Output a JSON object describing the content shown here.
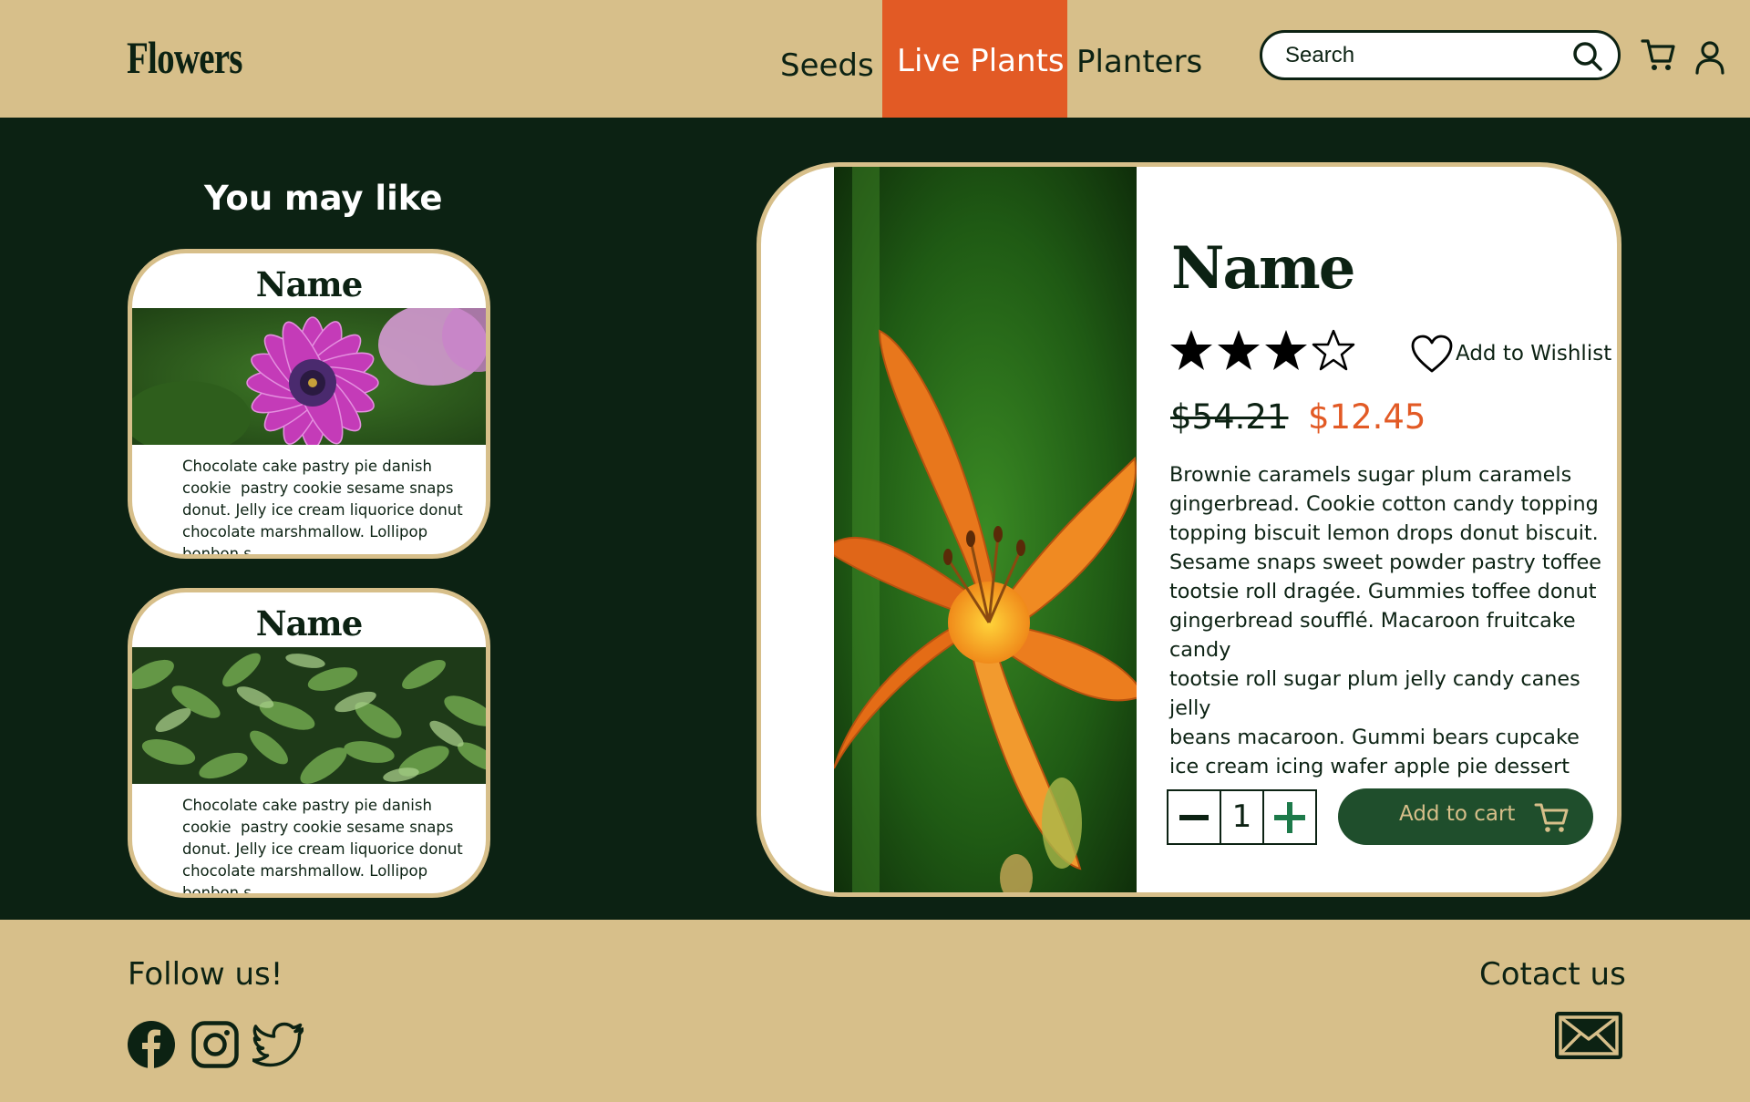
{
  "header": {
    "logo": "Flowers",
    "nav": [
      {
        "label": "Seeds",
        "active": false
      },
      {
        "label": "Live Plants",
        "active": true
      },
      {
        "label": "Planters",
        "active": false
      }
    ],
    "search_placeholder": "Search",
    "icons": [
      "search-icon",
      "cart-icon",
      "user-icon"
    ]
  },
  "sidebar": {
    "title": "You may like",
    "cards": [
      {
        "name": "Name",
        "image": "purple-daisy",
        "text": "Chocolate cake pastry pie danish cookie  pastry cookie sesame snaps donut. Jelly ice cream liquorice donut chocolate marshmallow. Lollipop bonbon s"
      },
      {
        "name": "Name",
        "image": "green-plants",
        "text": "Chocolate cake pastry pie danish cookie  pastry cookie sesame snaps donut. Jelly ice cream liquorice donut chocolate marshmallow. Lollipop bonbon s"
      }
    ]
  },
  "product": {
    "name": "Name",
    "image": "orange-lily",
    "rating": 3,
    "rating_max": 4,
    "wishlist_label": "Add to Wishlist",
    "old_price": "$54.21",
    "new_price": "$12.45",
    "description_lines": [
      "Brownie caramels sugar plum caramels",
      "gingerbread. Cookie cotton candy topping",
      "topping biscuit lemon drops donut biscuit.",
      "Sesame snaps sweet powder pastry toffee",
      "tootsie roll dragée. Gummies toffee donut",
      "gingerbread soufflé. Macaroon fruitcake candy",
      "tootsie roll sugar plum jelly candy canes jelly",
      "beans macaroon. Gummi bears cupcake",
      "ice cream icing wafer apple pie dessert sugar"
    ],
    "quantity": "1",
    "add_to_cart_label": "Add to cart"
  },
  "footer": {
    "follow_label": "Follow us!",
    "social": [
      "facebook-icon",
      "instagram-icon",
      "twitter-icon"
    ],
    "contact_label": "Cotact us"
  },
  "colors": {
    "tan": "#d7bf8a",
    "dark_green": "#0c2213",
    "accent_orange": "#e25a25",
    "button_green": "#1f4e2c",
    "plus_green": "#1d7a4a"
  }
}
